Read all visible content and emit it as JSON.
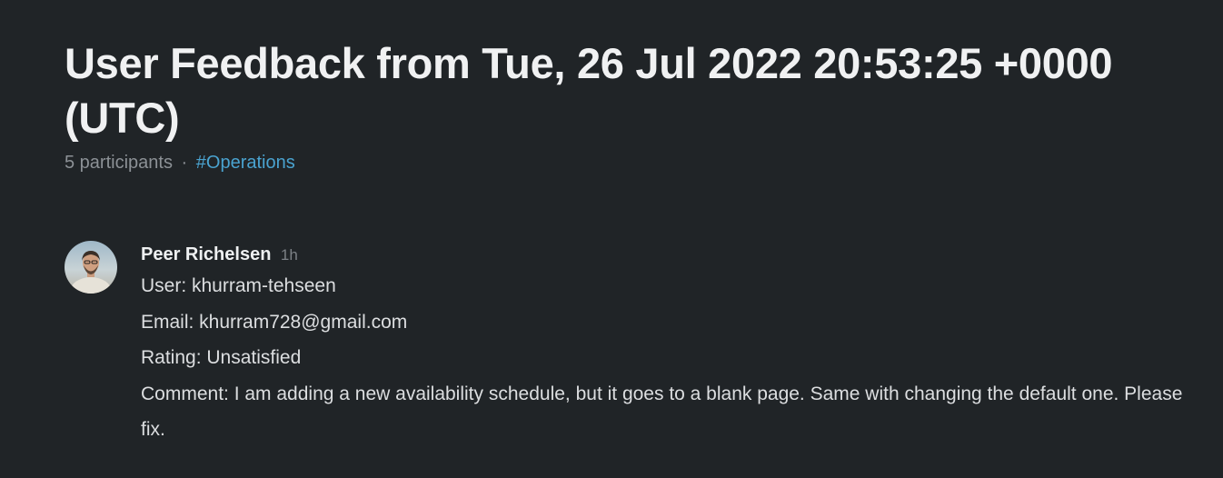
{
  "thread": {
    "title": "User Feedback from Tue, 26 Jul 2022 20:53:25 +0000 (UTC)",
    "participants": "5 participants",
    "separator": "·",
    "channel": "#Operations"
  },
  "message": {
    "author": "Peer Richelsen",
    "time": "1h",
    "lines": [
      "User: khurram-tehseen",
      "Email: khurram728@gmail.com",
      "Rating: Unsatisfied",
      "Comment: I am adding a new availability schedule, but it goes to a blank page. Same with changing the default one. Please fix."
    ]
  },
  "colors": {
    "background": "#202427",
    "link": "#4aa3d0",
    "muted": "#8c9196"
  }
}
